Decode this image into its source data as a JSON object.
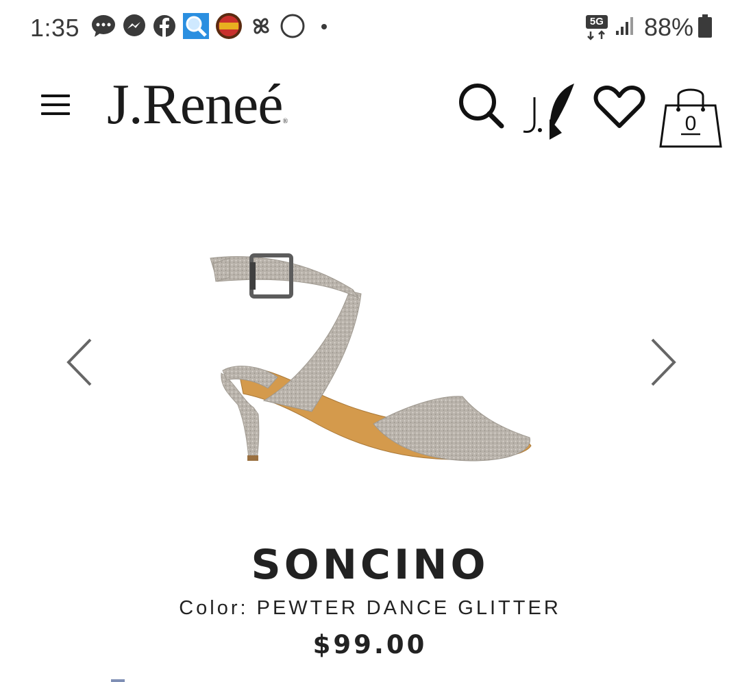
{
  "status_bar": {
    "time": "1:35",
    "notification_icons": [
      "chat-bubble-icon",
      "messenger-icon",
      "facebook-icon",
      "magnifier-app-icon",
      "konami-slots-icon",
      "pinwheel-icon",
      "circle-icon",
      "dot-icon"
    ],
    "network": "5G",
    "battery": "88%"
  },
  "header": {
    "logo": "J.Reneé",
    "logo_mark": "®",
    "icons": [
      "menu-icon",
      "search-icon",
      "jr-rewards-icon",
      "heart-icon",
      "shopping-bag-icon"
    ],
    "cart_count": "0"
  },
  "product": {
    "name": "SONCINO",
    "color_label": "Color:",
    "color_value": "PEWTER DANCE GLITTER",
    "price": "$99.00",
    "image": "pewter-glitter-sandal-image"
  },
  "colors": {
    "text": "#222222",
    "status_text": "#3a3a3a",
    "background": "#ffffff",
    "arrow": "#666666"
  }
}
